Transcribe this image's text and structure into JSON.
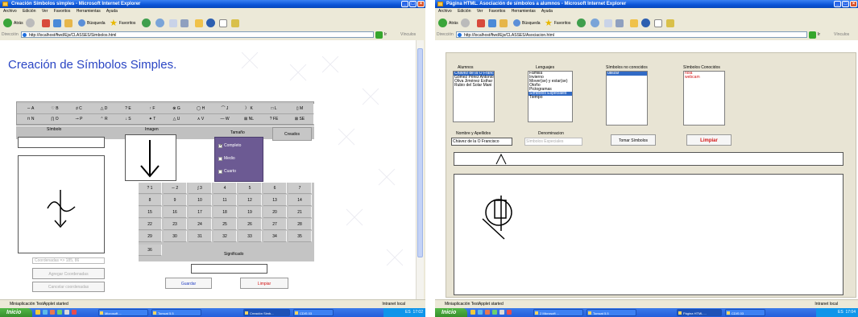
{
  "left_window": {
    "title": "Creación Símbolos simples - Microsoft Internet Explorer",
    "menu": [
      "Archivo",
      "Edición",
      "Ver",
      "Favoritos",
      "Herramientas",
      "Ayuda"
    ],
    "toolbar": {
      "back": "Atrás",
      "search": "Búsqueda",
      "favorites": "Favoritos"
    },
    "address": {
      "label": "Dirección",
      "url": "http://localhost/ftwd/Ejs/CLASSES/Simbolos.html",
      "go": "Ir",
      "links": "Vínculos"
    },
    "page": {
      "title": "Creación de Símbolos Simples.",
      "symbols_row1": [
        "∼ A",
        "♡ B",
        "♯ C",
        "△ D",
        "? E",
        "↑ F",
        "⊗ G",
        "◯ H",
        "⌒ J",
        "〉 K",
        "□ L",
        "▯ M"
      ],
      "symbols_row2": [
        "⊓ N",
        "∏ O",
        "⊸ P",
        "⌃ R",
        "↓ S",
        "✦ T",
        "△ U",
        "∧ V",
        "— W",
        "⊠ NL",
        "? FE",
        "⊠ SE"
      ],
      "simbolo_label": "Símbolo",
      "imagen_label": "Imagen",
      "tamano_label": "Tamaño",
      "size_options": [
        "Completo",
        "Medio",
        "Cuarto"
      ],
      "creados_button": "Creados",
      "coordinates_text": "Coordenadas => 185, 86",
      "agregar_button": "Agregar Coordenadas",
      "cancelar_button": "Cancelar coordenadas",
      "number_row1": [
        "? 1",
        "∼ 2",
        "∫ 3",
        "4",
        "5",
        "6",
        "7"
      ],
      "numbers": [
        "8",
        "9",
        "10",
        "11",
        "12",
        "13",
        "14",
        "15",
        "16",
        "17",
        "18",
        "19",
        "20",
        "21",
        "22",
        "23",
        "24",
        "25",
        "26",
        "27",
        "28",
        "29",
        "30",
        "31",
        "32",
        "33",
        "34",
        "35",
        "36"
      ],
      "significado_label": "Significado",
      "guardar_button": "Guardar",
      "limpiar_button": "Limpiar"
    },
    "status": {
      "text": "Miniaplicación TestApplet started",
      "zone": "Intranet local"
    }
  },
  "right_window": {
    "title": "Página HTML. Asociación de símbolos a alumnos - Microsoft Internet Explorer",
    "menu": [
      "Archivo",
      "Edición",
      "Ver",
      "Favoritos",
      "Herramientas",
      "Ayuda"
    ],
    "toolbar": {
      "back": "Atrás",
      "search": "Búsqueda",
      "favorites": "Favoritos"
    },
    "address": {
      "label": "Dirección",
      "url": "http://localhost/ftwd/Ejs/CLASSES/Asociacion.html",
      "go": "Ir",
      "links": "Vínculos"
    },
    "page": {
      "alumnos_label": "Alumnos",
      "alumnos": [
        "Chávez de la O  Franc",
        "Gómez Pérez  Antonio",
        "Oliva Jiménez  Esthar",
        "Rubio del Solar  Mani"
      ],
      "lenguajes_label": "Lenguajes",
      "lenguajes": [
        "Familia",
        "Invierno",
        "Mover(se) y estar(se)",
        "Otoño",
        "Pictogramas",
        "Símbolos Especiales",
        "Tiempo"
      ],
      "no_conocidos_label": "Símbolos no conocidos",
      "no_conocidos": [
        "utilizar"
      ],
      "conocidos_label": "Símbolos Conocidos",
      "conocidos": [
        "hola",
        "webcam"
      ],
      "nombre_label": "Nombre y Apellidos",
      "nombre_value": "Chávez de la O  Francisco",
      "denominacion_label": "Denominacion",
      "denominacion_value": "Símbolos Especiales",
      "tomar_button": "Tomar Símbolos",
      "limpiar_button": "Limpiar"
    },
    "status": {
      "text": "Miniaplicación TestApplet started",
      "zone": "Intranet local"
    }
  },
  "taskbar": {
    "start": "Inicio",
    "left_tasks": [
      "Microsoft ...",
      "Tomcat 5.5",
      "Creación Simb...",
      "CDIS 03"
    ],
    "left_clock": "17:02",
    "right_tasks": [
      "2 Microsoft ...",
      "Tomcat 5.5",
      "Página HTML ...",
      "CDIS 03"
    ],
    "right_clock": "17:04",
    "lang": "ES"
  },
  "colors": {
    "title_blue": "#2a45c4",
    "purple_panel": "#6c5a93",
    "limpiar_red": "#d41515",
    "selection": "#316ac5"
  }
}
